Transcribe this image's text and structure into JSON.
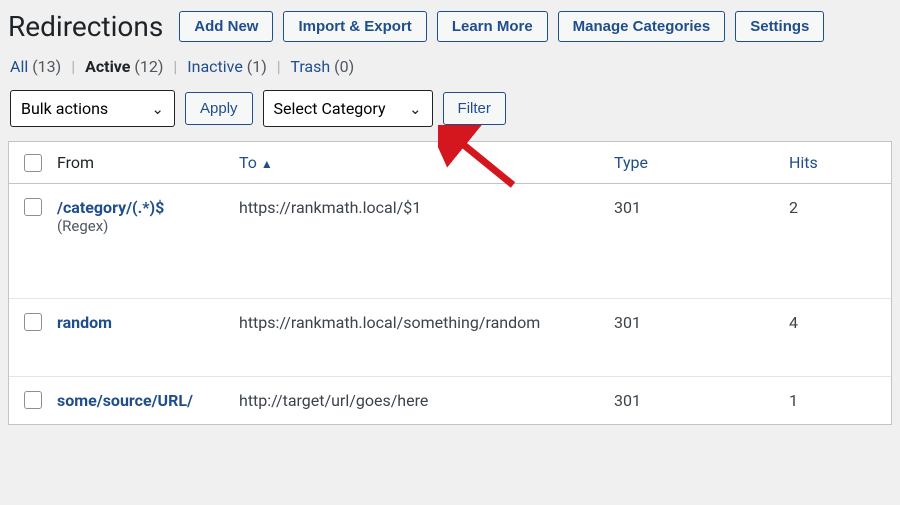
{
  "header": {
    "title": "Redirections",
    "buttons": [
      "Add New",
      "Import & Export",
      "Learn More",
      "Manage Categories",
      "Settings"
    ]
  },
  "filters": {
    "all": {
      "label": "All",
      "count": "(13)"
    },
    "active": {
      "label": "Active",
      "count": "(12)"
    },
    "inactive": {
      "label": "Inactive",
      "count": "(1)"
    },
    "trash": {
      "label": "Trash",
      "count": "(0)"
    }
  },
  "controls": {
    "bulk_label": "Bulk actions",
    "apply_label": "Apply",
    "category_label": "Select Category",
    "filter_label": "Filter"
  },
  "table": {
    "headers": {
      "from": "From",
      "to": "To",
      "type": "Type",
      "hits": "Hits"
    },
    "rows": [
      {
        "from": "/category/(.*)$",
        "from_sub": "(Regex)",
        "to": "https://rankmath.local/$1",
        "type": "301",
        "hits": "2"
      },
      {
        "from": "random",
        "from_sub": "",
        "to": "https://rankmath.local/something/random",
        "type": "301",
        "hits": "4"
      },
      {
        "from": "some/source/URL/",
        "from_sub": "",
        "to": "http://target/url/goes/here",
        "type": "301",
        "hits": "1"
      }
    ]
  }
}
